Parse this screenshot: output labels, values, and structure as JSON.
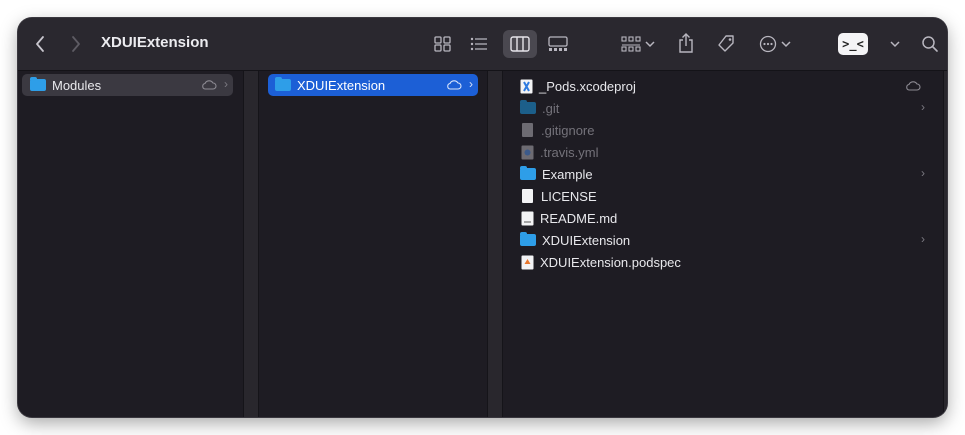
{
  "window": {
    "title": "XDUIExtension"
  },
  "toolbar": {
    "terminal_label": ">_<"
  },
  "columns": {
    "first": {
      "items": [
        {
          "label": "Modules",
          "kind": "folder",
          "selected": "gray",
          "cloud": true,
          "chevron": true
        }
      ]
    },
    "second": {
      "items": [
        {
          "label": "XDUIExtension",
          "kind": "folder",
          "selected": "blue",
          "cloud": true,
          "chevron": true
        }
      ]
    },
    "third": {
      "items": [
        {
          "label": "_Pods.xcodeproj",
          "kind": "xcodeproj",
          "cloud": true
        },
        {
          "label": ".git",
          "kind": "folder",
          "dim": true,
          "chevron": true
        },
        {
          "label": ".gitignore",
          "kind": "doc",
          "dim": true
        },
        {
          "label": ".travis.yml",
          "kind": "yml",
          "dim": true
        },
        {
          "label": "Example",
          "kind": "folder",
          "chevron": true
        },
        {
          "label": "LICENSE",
          "kind": "doc"
        },
        {
          "label": "README.md",
          "kind": "md"
        },
        {
          "label": "XDUIExtension",
          "kind": "folder",
          "chevron": true
        },
        {
          "label": "XDUIExtension.podspec",
          "kind": "podspec"
        }
      ]
    }
  },
  "colors": {
    "window_bg": "#1e1c23",
    "toolbar_bg": "#2a282f",
    "selection_blue": "#1c5fd6",
    "folder_blue": "#2e9ee8"
  }
}
